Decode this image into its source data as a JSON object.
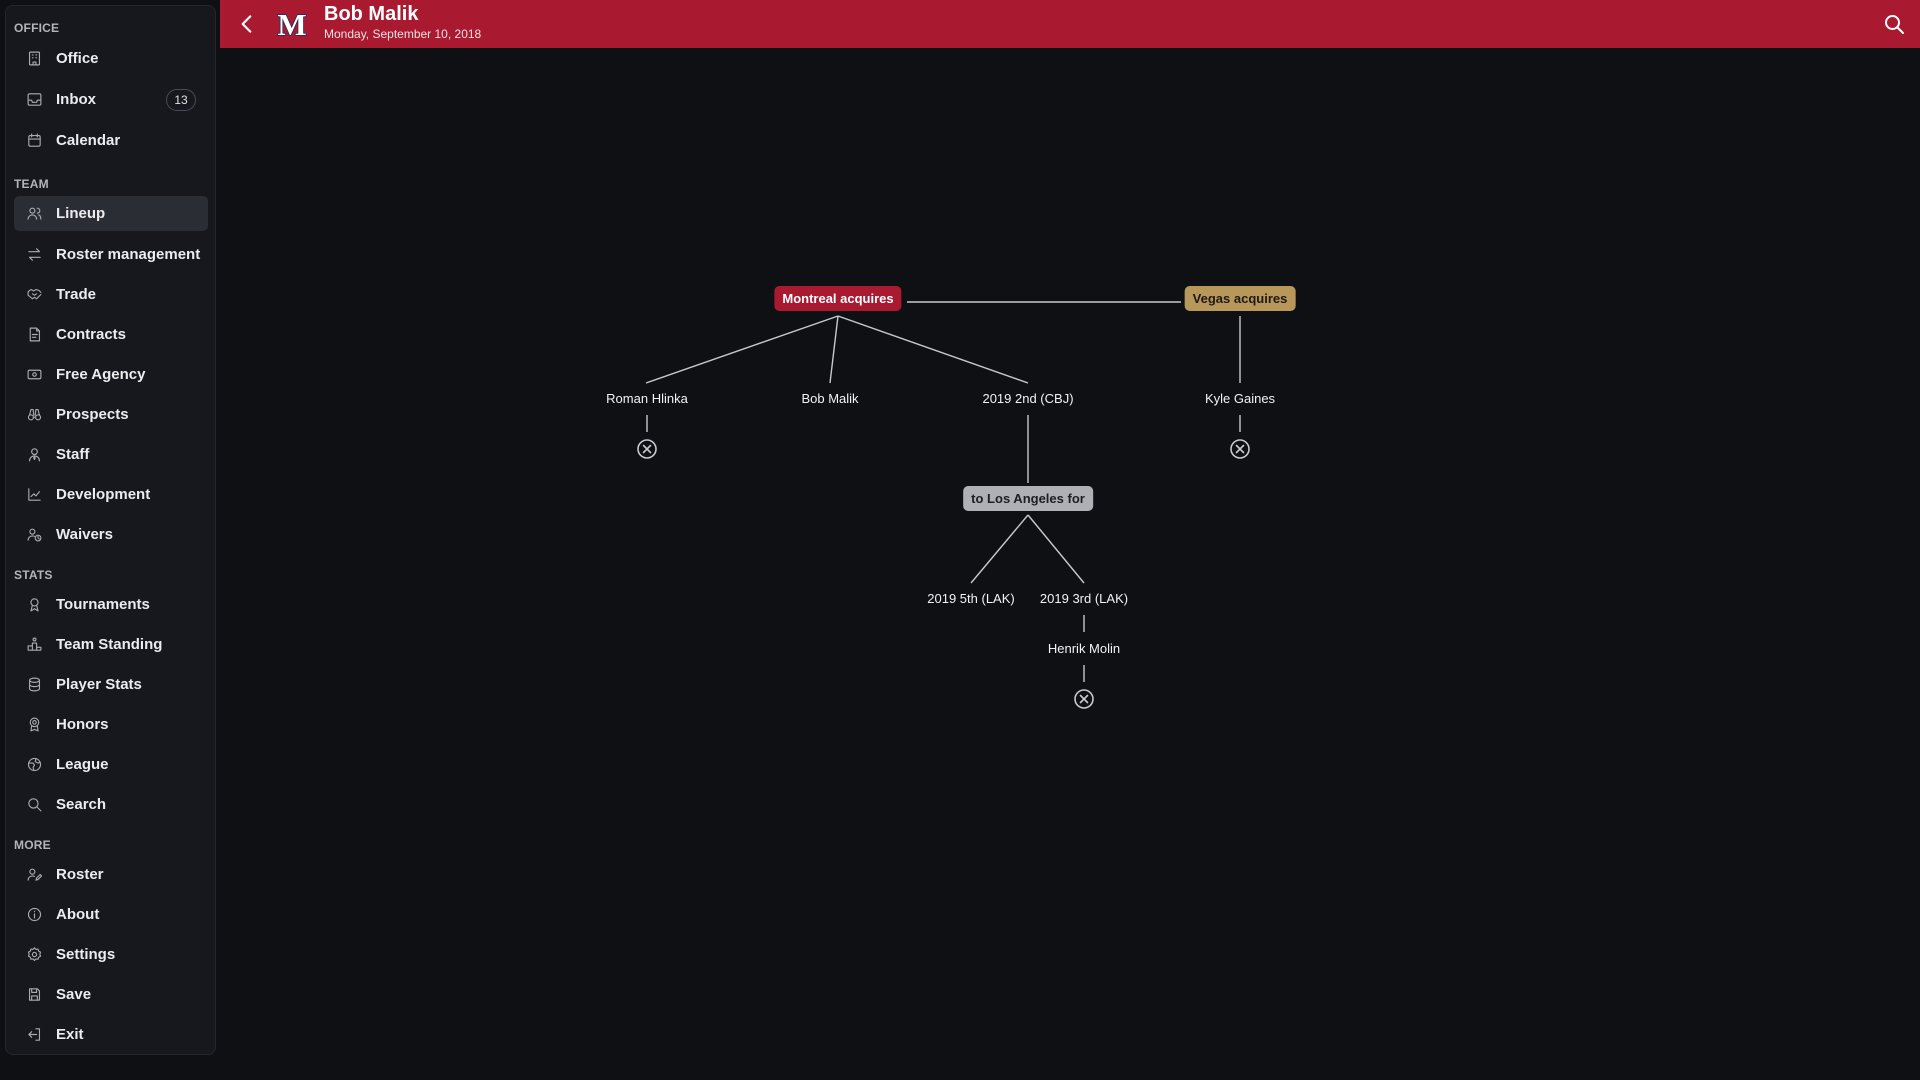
{
  "sidebar": {
    "sections": [
      {
        "title": "OFFICE",
        "items": [
          {
            "label": "Office",
            "icon": "building-icon"
          },
          {
            "label": "Inbox",
            "icon": "inbox-icon",
            "badge": "13"
          },
          {
            "label": "Calendar",
            "icon": "calendar-icon"
          }
        ]
      },
      {
        "title": "TEAM",
        "items": [
          {
            "label": "Lineup",
            "icon": "users-icon",
            "active": true
          },
          {
            "label": "Roster management",
            "icon": "arrows-exchange-icon"
          },
          {
            "label": "Trade",
            "icon": "handshake-icon"
          },
          {
            "label": "Contracts",
            "icon": "contract-icon"
          },
          {
            "label": "Free Agency",
            "icon": "cash-icon"
          },
          {
            "label": "Prospects",
            "icon": "binoculars-icon"
          },
          {
            "label": "Staff",
            "icon": "user-tie-icon"
          },
          {
            "label": "Development",
            "icon": "chart-line-icon"
          },
          {
            "label": "Waivers",
            "icon": "user-clock-icon"
          }
        ]
      },
      {
        "title": "STATS",
        "items": [
          {
            "label": "Tournaments",
            "icon": "trophy-icon"
          },
          {
            "label": "Team Standing",
            "icon": "podium-icon"
          },
          {
            "label": "Player Stats",
            "icon": "database-icon"
          },
          {
            "label": "Honors",
            "icon": "award-icon"
          },
          {
            "label": "League",
            "icon": "globe-icon"
          },
          {
            "label": "Search",
            "icon": "search-icon"
          }
        ]
      },
      {
        "title": "MORE",
        "items": [
          {
            "label": "Roster",
            "icon": "user-edit-icon"
          },
          {
            "label": "About",
            "icon": "info-icon"
          },
          {
            "label": "Settings",
            "icon": "gear-icon"
          },
          {
            "label": "Save",
            "icon": "floppy-icon"
          },
          {
            "label": "Exit",
            "icon": "logout-icon"
          }
        ]
      }
    ]
  },
  "header": {
    "title": "Bob Malik",
    "date": "Monday, September 10, 2018",
    "logo_letter": "M",
    "accent_color": "#a91a30"
  },
  "trade_tree": {
    "montreal_label": "Montreal acquires",
    "vegas_label": "Vegas acquires",
    "montreal_assets": [
      "Roman Hlinka",
      "Bob Malik",
      "2019 2nd (CBJ)"
    ],
    "vegas_assets": [
      "Kyle Gaines"
    ],
    "subtrade_label": "to Los Angeles for",
    "subtrade_assets": [
      "2019 5th (LAK)",
      "2019 3rd (LAK)"
    ],
    "pick_selection": "Henrik Molin",
    "colors": {
      "montreal": "#a91a30",
      "vegas": "#b8975a",
      "losangeles": "#aeb0b6"
    }
  }
}
